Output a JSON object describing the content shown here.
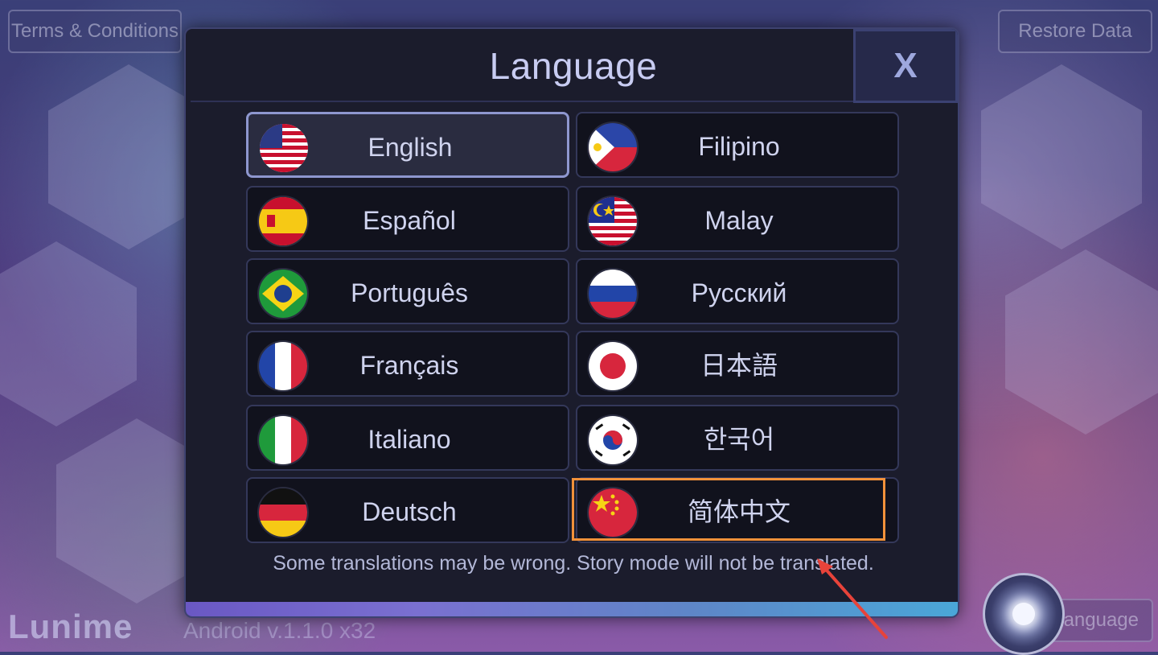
{
  "top_buttons": {
    "terms": "Terms & Conditions",
    "restore": "Restore Data"
  },
  "footer": {
    "brand": "Lunime",
    "version": "Android v.1.1.0 x32",
    "language_button": "Language"
  },
  "dialog": {
    "title": "Language",
    "close_label": "X",
    "note": "Some translations may be wrong. Story mode will not be translated.",
    "languages": [
      {
        "label": "English",
        "flag": "us-flag-icon"
      },
      {
        "label": "Filipino",
        "flag": "philippines-flag-icon"
      },
      {
        "label": "Español",
        "flag": "spain-flag-icon"
      },
      {
        "label": "Malay",
        "flag": "malaysia-flag-icon"
      },
      {
        "label": "Português",
        "flag": "brazil-flag-icon"
      },
      {
        "label": "Русский",
        "flag": "russia-flag-icon"
      },
      {
        "label": "Français",
        "flag": "france-flag-icon"
      },
      {
        "label": "日本語",
        "flag": "japan-flag-icon"
      },
      {
        "label": "Italiano",
        "flag": "italy-flag-icon"
      },
      {
        "label": "한국어",
        "flag": "korea-flag-icon"
      },
      {
        "label": "Deutsch",
        "flag": "germany-flag-icon"
      },
      {
        "label": "简体中文",
        "flag": "china-flag-icon"
      }
    ],
    "selected": "English",
    "highlighted": "简体中文"
  },
  "colors": {
    "dialog_bg": "#1b1c2c",
    "button_bg": "#11121d",
    "text": "#cfd3ee",
    "highlight": "#f2913a",
    "arrow": "#e8433a"
  }
}
